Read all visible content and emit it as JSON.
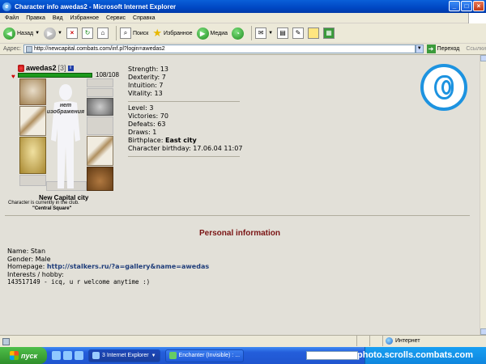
{
  "window": {
    "title": "Character info awedas2 - Microsoft Internet Explorer"
  },
  "menu": [
    "Файл",
    "Правка",
    "Вид",
    "Избранное",
    "Сервис",
    "Справка"
  ],
  "toolbar": {
    "back": "Назад",
    "search": "Поиск",
    "favorites": "Избранное",
    "media": "Медиа"
  },
  "address": {
    "label": "Адрес:",
    "url": "http://newcapital.combats.com/inf.pl?login=awedas2",
    "go": "Переход",
    "links": "Ссылки"
  },
  "character": {
    "name": "awedas2",
    "level": "[3]",
    "info_icon": "i",
    "hp": "108/108",
    "hp_fraction": 1.0,
    "no_image": "нет изображения",
    "city": "New Capital city",
    "club_text": "Character is currently in the club.",
    "club_location": "\"Central Square\""
  },
  "stats": {
    "strength": "Strength: 13",
    "dexterity": "Dexterity: 7",
    "intuition": "Intuition: 7",
    "vitality": "Vitality: 13",
    "level": "Level: 3",
    "victories": "Victories: 70",
    "defeats": "Defeats: 63",
    "draws": "Draws: 1",
    "birthplace_label": "Birthplace:",
    "birthplace_value": "East city",
    "birthday": "Character birthday: 17.06.04 11:07"
  },
  "personal": {
    "title": "Personal information",
    "name": "Name: Stan",
    "gender": "Gender: Male",
    "homepage_label": "Homepage:",
    "homepage_url": "http://stalkers.ru/?a=gallery&name=awedas",
    "interests_label": "Interests / hobby:",
    "interests": "143517149 - icq, u r welcome anytime :)"
  },
  "statusbar": {
    "zone": "Интернет"
  },
  "taskbar": {
    "start": "пуск",
    "tasks": [
      "3 Internet Explorer",
      "Enchanter (Invisible) : ..."
    ],
    "watermark": "photo.scrolls.combats.com"
  }
}
